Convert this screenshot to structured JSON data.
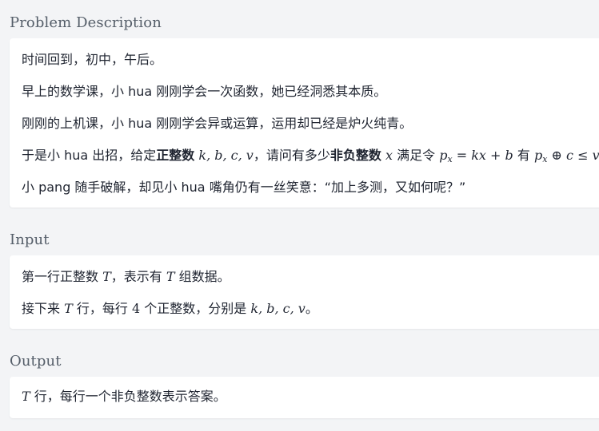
{
  "sections": {
    "problem": {
      "title": "Problem Description",
      "lines": {
        "l1": "时间回到，初中，午后。",
        "l2": "早上的数学课，小 hua 刚刚学会一次函数，她已经洞悉其本质。",
        "l3": "刚刚的上机课，小 hua 刚刚学会异或运算，运用却已经是炉火纯青。",
        "l4": {
          "t1": "于是小 hua 出招，给定",
          "b1": "正整数",
          "m1": "k, b, c, v",
          "t2": "，请问有多少",
          "b2": "非负整数",
          "m2": "x",
          "t3": "满足令",
          "m3a": "p",
          "m3sub": "x",
          "m3b": " = kx + b",
          "t4": "有",
          "m4a": "p",
          "m4sub": "x",
          "m4b": " ⊕ c ≤ v",
          "t5": "。"
        },
        "l5": "小 pang 随手破解，却见小 hua 嘴角仍有一丝笑意：“加上多测，又如何呢？”"
      }
    },
    "input": {
      "title": "Input",
      "lines": {
        "l1": {
          "t1": "第一行正整数",
          "m1": "T",
          "t2": "，表示有",
          "m2": "T",
          "t3": "组数据。"
        },
        "l2": {
          "t1": "接下来",
          "m1": "T",
          "t2": "行，每行",
          "m2": "4",
          "t3": "个正整数，分别是",
          "m3": "k, b, c, v",
          "t4": "。"
        }
      }
    },
    "output": {
      "title": "Output",
      "lines": {
        "l1": {
          "m1": "T",
          "t1": "行，每行一个非负整数表示答案。"
        }
      }
    }
  },
  "colors": {
    "background": "#f3f4f6",
    "card": "#ffffff",
    "title": "#555e69",
    "text": "#1f2430"
  }
}
